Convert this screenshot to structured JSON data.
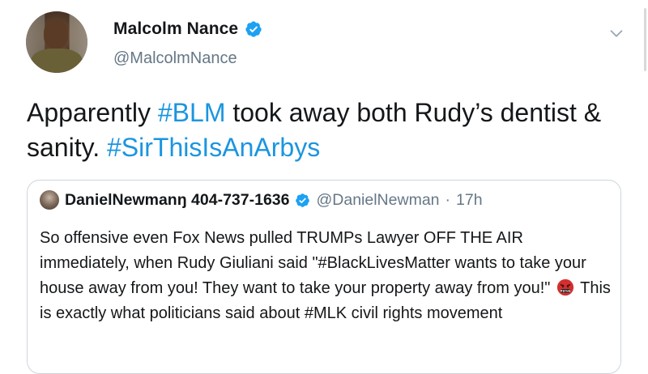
{
  "author": {
    "name": "Malcolm Nance",
    "handle": "@MalcolmNance"
  },
  "tweet": {
    "text_part1": "Apparently ",
    "hashtag1": "#BLM",
    "text_part2": " took away both Rudy’s dentist & sanity.  ",
    "hashtag2": "#SirThisIsAnArbys"
  },
  "quoted_tweet": {
    "name": "DanielNewmanŋ 404-737-1636",
    "handle": "@DanielNewman",
    "separator": "·",
    "time": "17h",
    "body_part1": "So offensive even Fox News pulled TRUMPs Lawyer OFF THE AIR immediately, when Rudy Giuliani said \"#BlackLivesMatter wants to take your house away from you! They want to take your property away from you!\"",
    "body_part2": "This is exactly what politicians said about #MLK civil rights movement",
    "emoji": "face-with-symbols-on-mouth"
  },
  "icons": {
    "verified": "verified-badge-icon",
    "menu": "chevron-down-icon"
  },
  "colors": {
    "link": "#1b95e0",
    "secondary_text": "#657786",
    "border": "#ccd6dd",
    "verified": "#1da1f2"
  }
}
